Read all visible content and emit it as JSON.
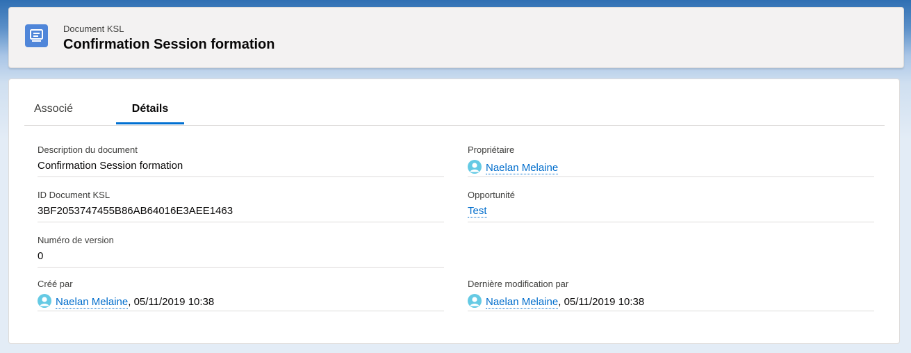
{
  "header": {
    "object_type": "Document KSL",
    "record_title": "Confirmation Session formation",
    "icon": "document-icon",
    "icon_color": "#4f86d9"
  },
  "tabs": [
    {
      "label": "Associé",
      "active": false
    },
    {
      "label": "Détails",
      "active": true
    }
  ],
  "fields": {
    "description": {
      "label": "Description du document",
      "value": "Confirmation Session formation"
    },
    "owner": {
      "label": "Propriétaire",
      "value": "Naelan Melaine"
    },
    "document_id": {
      "label": "ID Document KSL",
      "value": "3BF2053747455B86AB64016E3AEE1463"
    },
    "opportunity": {
      "label": "Opportunité",
      "value": "Test"
    },
    "version": {
      "label": "Numéro de version",
      "value": "0"
    },
    "created_by": {
      "label": "Créé par",
      "user": "Naelan Melaine",
      "date": ", 05/11/2019 10:38"
    },
    "modified_by": {
      "label": "Dernière modification par",
      "user": "Naelan Melaine",
      "date": ", 05/11/2019 10:38"
    }
  },
  "colors": {
    "link": "#006dcc",
    "tab_active_border": "#0070d2",
    "avatar": "#65cae4",
    "brand_background": "#1a5ea8"
  }
}
